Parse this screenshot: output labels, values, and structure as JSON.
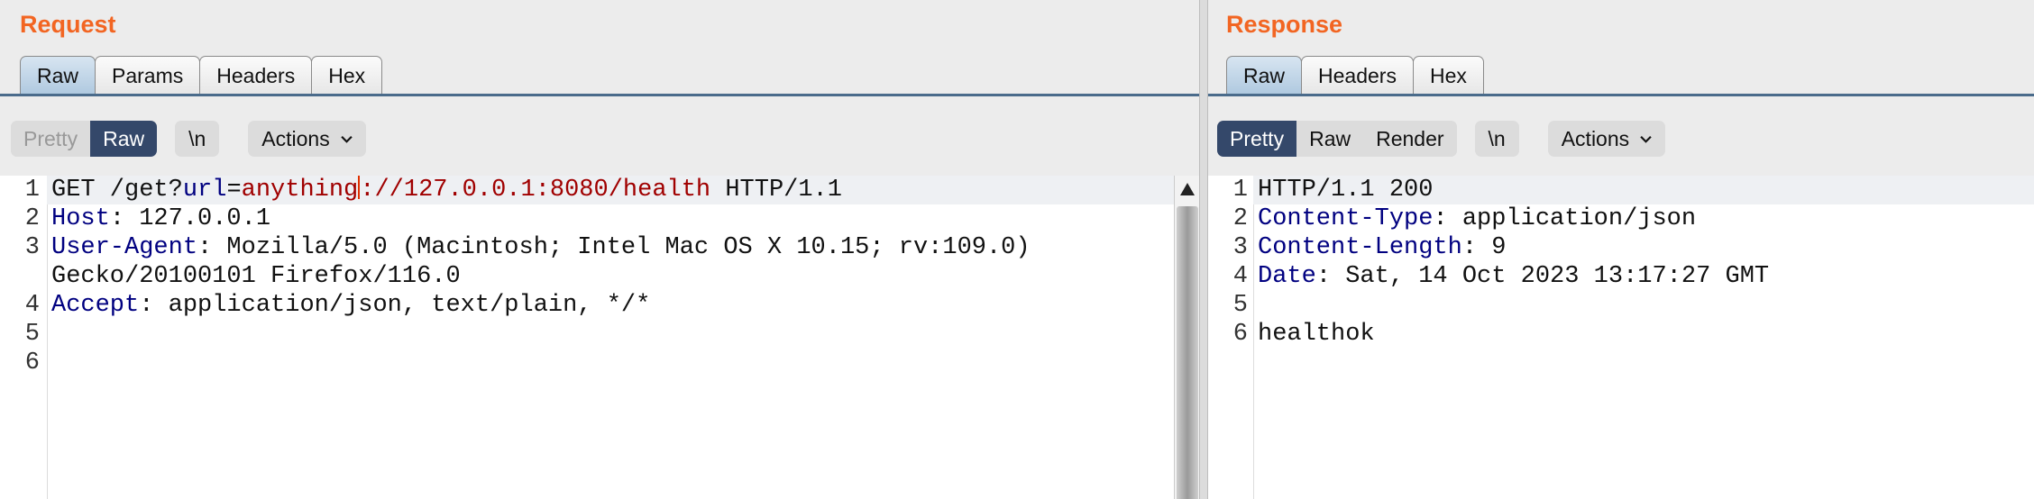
{
  "request": {
    "title": "Request",
    "tabs": [
      "Raw",
      "Params",
      "Headers",
      "Hex"
    ],
    "toolbar": {
      "pretty": "Pretty",
      "raw": "Raw",
      "newline": "\\n",
      "actions": "Actions"
    },
    "lines": [
      {
        "n": "1"
      },
      {
        "n": "2"
      },
      {
        "n": "3"
      },
      {
        "n": "4"
      },
      {
        "n": "5"
      },
      {
        "n": "6"
      }
    ],
    "code": {
      "l1_method_path": "GET /get?",
      "l1_param": "url",
      "l1_eq": "=",
      "l1_value_a": "anything",
      "l1_value_b": "://127.0.0.1:8080/health",
      "l1_proto": " HTTP/1.1",
      "l2_key": "Host",
      "l2_val": ": 127.0.0.1",
      "l3_key": "User-Agent",
      "l3_val": ": Mozilla/5.0 (Macintosh; Intel Mac OS X 10.15; rv:109.0)",
      "l3_cont": "Gecko/20100101 Firefox/116.0",
      "l4_key": "Accept",
      "l4_val": ": application/json, text/plain, */*"
    }
  },
  "response": {
    "title": "Response",
    "tabs": [
      "Raw",
      "Headers",
      "Hex"
    ],
    "toolbar": {
      "pretty": "Pretty",
      "raw": "Raw",
      "render": "Render",
      "newline": "\\n",
      "actions": "Actions"
    },
    "lines": [
      {
        "n": "1"
      },
      {
        "n": "2"
      },
      {
        "n": "3"
      },
      {
        "n": "4"
      },
      {
        "n": "5"
      },
      {
        "n": "6"
      }
    ],
    "code": {
      "l1": "HTTP/1.1 200",
      "l2_key": "Content-Type",
      "l2_val": ": application/json",
      "l3_key": "Content-Length",
      "l3_val": ": 9",
      "l4_key": "Date",
      "l4_val": ": Sat, 14 Oct 2023 13:17:27 GMT",
      "l6": "healthok"
    }
  },
  "colors": {
    "title": "#f26522",
    "header_key": "#000080",
    "param_value": "#a00000",
    "active_segment": "#34486a"
  }
}
